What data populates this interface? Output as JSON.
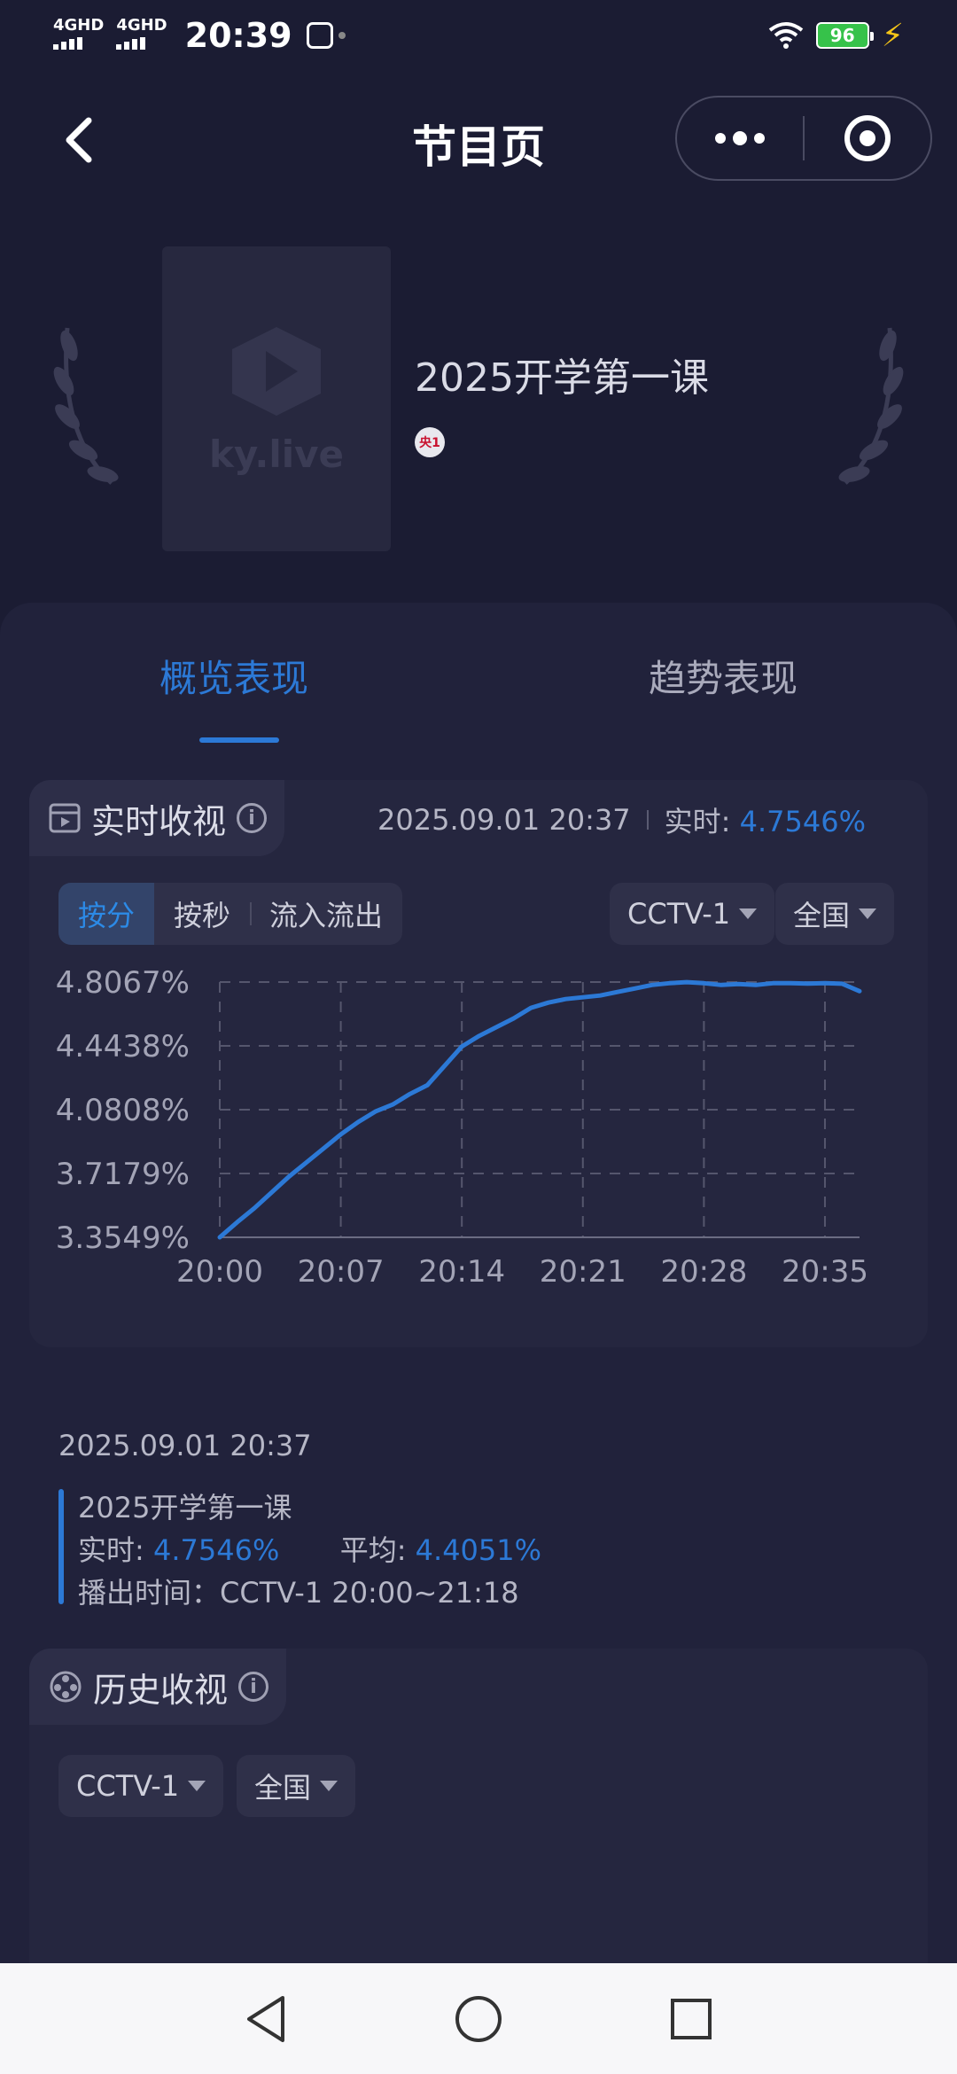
{
  "status_bar": {
    "signal1": "4GHD",
    "signal2": "4GHD",
    "time": "20:39",
    "battery": "96"
  },
  "nav": {
    "title": "节目页"
  },
  "program": {
    "poster_brand": "ky.live",
    "title": "2025开学第一课",
    "channel_badge": "央1"
  },
  "tabs": [
    {
      "label": "概览表现",
      "active": true
    },
    {
      "label": "趋势表现",
      "active": false
    }
  ],
  "realtime": {
    "section_title": "实时收视",
    "timestamp": "2025.09.01 20:37",
    "live_label": "实时:",
    "live_value": "4.7546%",
    "modes": [
      "按分",
      "按秒",
      "流入流出"
    ],
    "channel_select": "CCTV-1",
    "region_select": "全国",
    "summary": {
      "time": "2025.09.01 20:37",
      "program": "2025开学第一课",
      "live_label": "实时:",
      "live_value": "4.7546%",
      "avg_label": "平均:",
      "avg_value": "4.4051%",
      "airtime": "播出时间：CCTV-1 20:00~21:18"
    }
  },
  "chart_data": {
    "type": "line",
    "x_tick_labels": [
      "20:00",
      "20:07",
      "20:14",
      "20:21",
      "20:28",
      "20:35"
    ],
    "y_tick_labels": [
      "4.8067%",
      "4.4438%",
      "4.0808%",
      "3.7179%",
      "3.3549%"
    ],
    "ylim": [
      3.3549,
      4.8067
    ],
    "xlim": [
      0,
      37
    ],
    "grid": true,
    "series": [
      {
        "color": "#2c79d6",
        "x": [
          0,
          1,
          2,
          3,
          4,
          5,
          6,
          7,
          8,
          9,
          10,
          11,
          12,
          13,
          14,
          15,
          16,
          17,
          18,
          19,
          20,
          21,
          22,
          23,
          24,
          25,
          26,
          27,
          28,
          29,
          30,
          31,
          32,
          33,
          34,
          35,
          36,
          37
        ],
        "y": [
          3.3549,
          3.44,
          3.52,
          3.61,
          3.7,
          3.78,
          3.86,
          3.94,
          4.01,
          4.07,
          4.11,
          4.17,
          4.22,
          4.33,
          4.44,
          4.5,
          4.55,
          4.6,
          4.66,
          4.69,
          4.71,
          4.72,
          4.73,
          4.75,
          4.77,
          4.79,
          4.8,
          4.806,
          4.8,
          4.79,
          4.795,
          4.79,
          4.8,
          4.8,
          4.798,
          4.8,
          4.797,
          4.7546
        ]
      }
    ]
  },
  "history": {
    "section_title": "历史收视",
    "channel_select": "CCTV-1",
    "region_select": "全国"
  }
}
